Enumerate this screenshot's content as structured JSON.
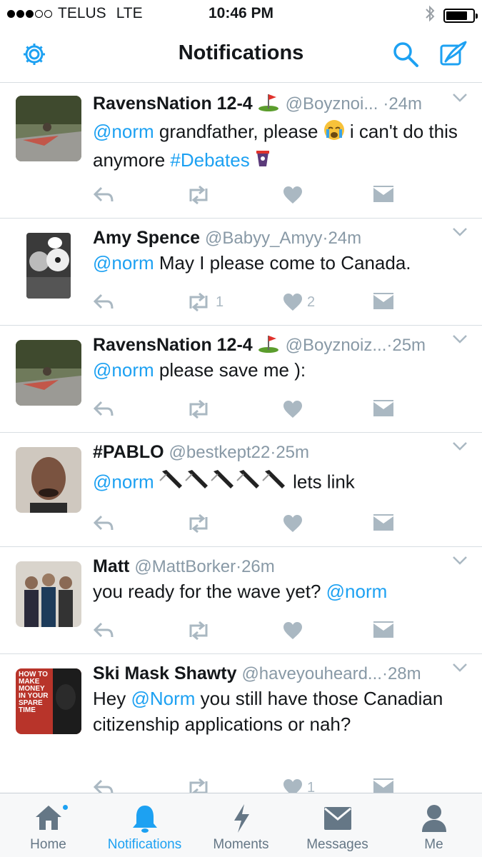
{
  "status_bar": {
    "carrier": "TELUS",
    "network": "LTE",
    "time": "10:46 PM"
  },
  "nav": {
    "title": "Notifications",
    "left_icon": "gear-icon",
    "right_icons": [
      "search-icon",
      "compose-icon"
    ]
  },
  "colors": {
    "accent": "#1da1f2",
    "muted": "#8899a6",
    "action": "#aab8c2"
  },
  "tweets": [
    {
      "name": "RavensNation 12-4",
      "handle": "@Boyznoi...",
      "time": "24m",
      "text": {
        "mention": "@norm",
        "before": "",
        "middle": " grandfather, please ",
        "after": " i can't do this anymore ",
        "hashtag": "#Debates"
      },
      "retweets": "",
      "likes": ""
    },
    {
      "name": "Amy Spence",
      "handle": "@Babyy_Amyy",
      "time": "24m",
      "text": {
        "mention": "@norm",
        "rest": " May I please come to Canada."
      },
      "retweets": "1",
      "likes": "2"
    },
    {
      "name": "RavensNation 12-4",
      "handle": "@Boyznoiz...",
      "time": "25m",
      "text": {
        "mention": "@norm",
        "rest": " please save me ):"
      },
      "retweets": "",
      "likes": ""
    },
    {
      "name": "#PABLO",
      "handle": "@bestkept22",
      "time": "25m",
      "text": {
        "mention": "@norm",
        "rest": " lets link"
      },
      "retweets": "",
      "likes": ""
    },
    {
      "name": "Matt",
      "handle": "@MattBorker",
      "time": "26m",
      "text": {
        "before": "you ready for the wave yet? ",
        "mention": "@norm"
      },
      "retweets": "",
      "likes": ""
    },
    {
      "name": "Ski Mask Shawty",
      "handle": "@haveyouheard...",
      "time": "28m",
      "text": {
        "before": "Hey ",
        "mention": "@Norm",
        "rest": " you still have those Canadian citizenship applications or nah?"
      },
      "avatar_text": "HOW TO MAKE MONEY IN YOUR SPARE TIME",
      "retweets": "",
      "likes": "1"
    }
  ],
  "tabs": [
    {
      "label": "Home",
      "icon": "home-icon",
      "active": false,
      "badge": true
    },
    {
      "label": "Notifications",
      "icon": "bell-icon",
      "active": true
    },
    {
      "label": "Moments",
      "icon": "lightning-icon",
      "active": false
    },
    {
      "label": "Messages",
      "icon": "envelope-icon",
      "active": false
    },
    {
      "label": "Me",
      "icon": "person-icon",
      "active": false
    }
  ],
  "separator": "·"
}
